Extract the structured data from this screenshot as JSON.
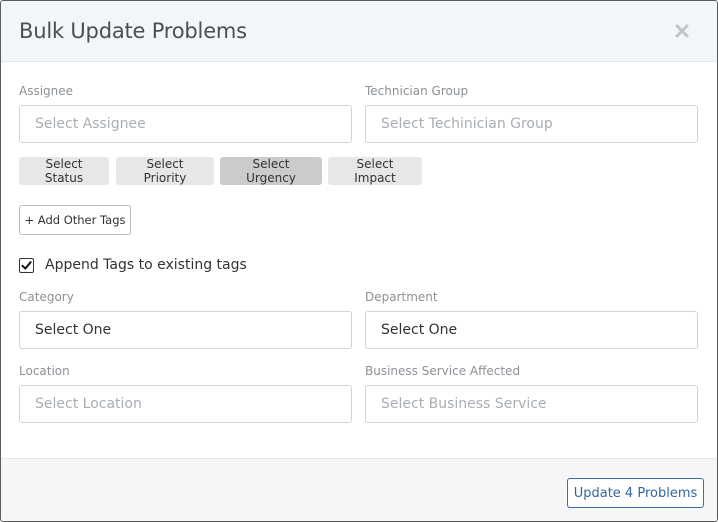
{
  "modal": {
    "title": "Bulk Update Problems"
  },
  "fields": {
    "assignee": {
      "label": "Assignee",
      "placeholder": "Select Assignee"
    },
    "technician_group": {
      "label": "Technician Group",
      "placeholder": "Select Techinician Group"
    },
    "category": {
      "label": "Category",
      "value": "Select One"
    },
    "department": {
      "label": "Department",
      "value": "Select One"
    },
    "location": {
      "label": "Location",
      "placeholder": "Select Location"
    },
    "business_service": {
      "label": "Business Service Affected",
      "placeholder": "Select Business Service"
    }
  },
  "tag_buttons": {
    "status": "Select Status",
    "priority": "Select Priority",
    "urgency": "Select Urgency",
    "impact": "Select Impact"
  },
  "add_other_tags": "+ Add Other Tags",
  "append_tags": {
    "label": "Append Tags to existing tags",
    "checked": true
  },
  "footer": {
    "update_label": "Update 4 Problems"
  },
  "colors": {
    "accent": "#2f67a3",
    "header_bg": "#f2f6f8"
  }
}
